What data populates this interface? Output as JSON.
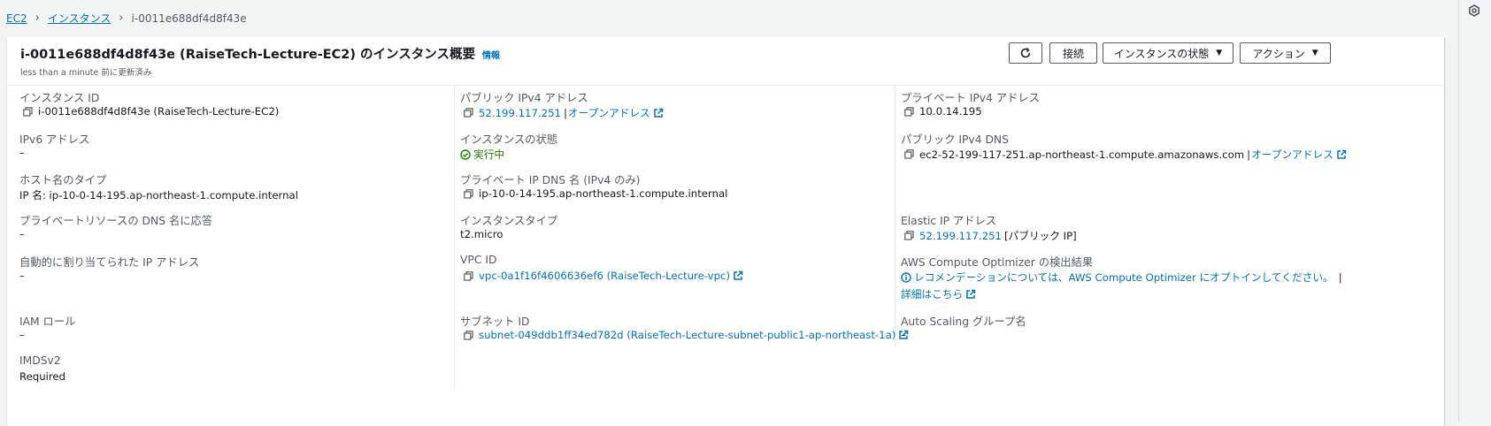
{
  "breadcrumb": {
    "items": [
      "EC2",
      "インスタンス"
    ],
    "current": "i-0011e688df4d8f43e"
  },
  "header": {
    "title": "i-0011e688df4d8f43e (RaiseTech-Lecture-EC2) のインスタンス概要",
    "info": "情報",
    "updated": "less than a minute 前に更新済み",
    "buttons": {
      "connect": "接続",
      "instance_state": "インスタンスの状態",
      "actions": "アクション"
    }
  },
  "colors": {
    "link": "#0073bb",
    "running": "#1d8102",
    "label": "#545b64"
  },
  "fields": {
    "instance_id": {
      "label": "インスタンス ID",
      "value": "i-0011e688df4d8f43e (RaiseTech-Lecture-EC2)"
    },
    "ipv6": {
      "label": "IPv6 アドレス",
      "value": "–"
    },
    "hostname_type": {
      "label": "ホスト名のタイプ",
      "value": "IP 名: ip-10-0-14-195.ap-northeast-1.compute.internal"
    },
    "private_dns_answer": {
      "label": "プライベートリソースの DNS 名に応答",
      "value": "–"
    },
    "auto_ip": {
      "label": "自動的に割り当てられた IP アドレス",
      "value": "–"
    },
    "iam_role": {
      "label": "IAM ロール",
      "value": "–"
    },
    "imdsv2": {
      "label": "IMDSv2",
      "value": "Required"
    },
    "public_ipv4": {
      "label": "パブリック IPv4 アドレス",
      "value": "52.199.117.251",
      "open": "オープンアドレス"
    },
    "state": {
      "label": "インスタンスの状態",
      "value": "実行中"
    },
    "private_ip_dns": {
      "label": "プライベート IP DNS 名 (IPv4 のみ)",
      "value": "ip-10-0-14-195.ap-northeast-1.compute.internal"
    },
    "instance_type": {
      "label": "インスタンスタイプ",
      "value": "t2.micro"
    },
    "vpc_id": {
      "label": "VPC ID",
      "value": "vpc-0a1f16f4606636ef6 (RaiseTech-Lecture-vpc)"
    },
    "subnet_id": {
      "label": "サブネット ID",
      "value": "subnet-049ddb1ff34ed782d (RaiseTech-Lecture-subnet-public1-ap-northeast-1a)"
    },
    "private_ipv4": {
      "label": "プライベート IPv4 アドレス",
      "value": "10.0.14.195"
    },
    "public_dns": {
      "label": "パブリック IPv4 DNS",
      "value": "ec2-52-199-117-251.ap-northeast-1.compute.amazonaws.com",
      "open": "オープンアドレス"
    },
    "elastic_ip": {
      "label": "Elastic IP アドレス",
      "value": "52.199.117.251",
      "suffix": "[パブリック IP]"
    },
    "optimizer": {
      "label": "AWS Compute Optimizer の検出結果",
      "value": "レコメンデーションについては、AWS Compute Optimizer にオプトインしてください。",
      "details": "詳細はこちら"
    },
    "autoscaling": {
      "label": "Auto Scaling グループ名",
      "value": "–"
    }
  }
}
